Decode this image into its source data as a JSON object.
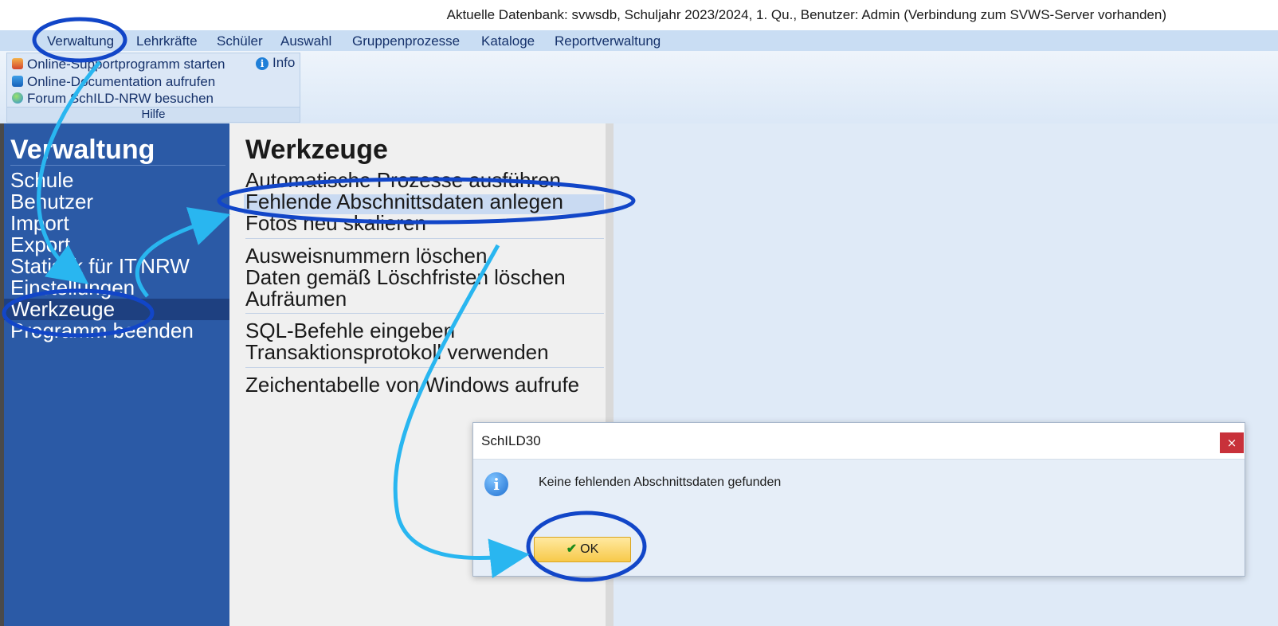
{
  "app": {
    "title": "Aktuelle Datenbank: svwsdb, Schuljahr 2023/2024, 1. Qu., Benutzer: Admin (Verbindung zum SVWS-Server vorhanden)"
  },
  "menu": {
    "items": [
      "Verwaltung",
      "Lehrkräfte",
      "Schüler",
      "Auswahl",
      "Gruppenprozesse",
      "Kataloge",
      "Reportverwaltung"
    ]
  },
  "ribbon": {
    "hilfe": {
      "caption": "Hilfe",
      "items": [
        "Online-Supportprogramm starten",
        "Online-Documentation aufrufen",
        "Forum SchILD-NRW besuchen"
      ],
      "info": "Info"
    }
  },
  "sidebar": {
    "heading": "Verwaltung",
    "items": [
      "Schule",
      "Benutzer",
      "Import",
      "Export",
      "Statistik für IT.NRW",
      "Einstellungen",
      "Werkzeuge",
      "Programm beenden"
    ],
    "selected": "Werkzeuge"
  },
  "content": {
    "heading": "Werkzeuge",
    "groups": [
      [
        "Automatische Prozesse ausführen",
        "Fehlende Abschnittsdaten anlegen",
        "Fotos neu skalieren"
      ],
      [
        "Ausweisnummern löschen",
        "Daten gemäß Löschfristen löschen",
        "Aufräumen"
      ],
      [
        "SQL-Befehle eingeben",
        "Transaktionsprotokoll verwenden"
      ],
      [
        "Zeichentabelle von Windows aufrufe"
      ]
    ],
    "highlighted": "Fehlende Abschnittsdaten anlegen"
  },
  "dialog": {
    "title": "SchILD30",
    "message": "Keine fehlenden Abschnittsdaten gefunden",
    "ok_label": "OK",
    "close_label": "×"
  },
  "colors": {
    "sidebar": "#2b5aa6",
    "annotation_arrow": "#29b6f0",
    "annotation_ring": "#1246c8"
  }
}
